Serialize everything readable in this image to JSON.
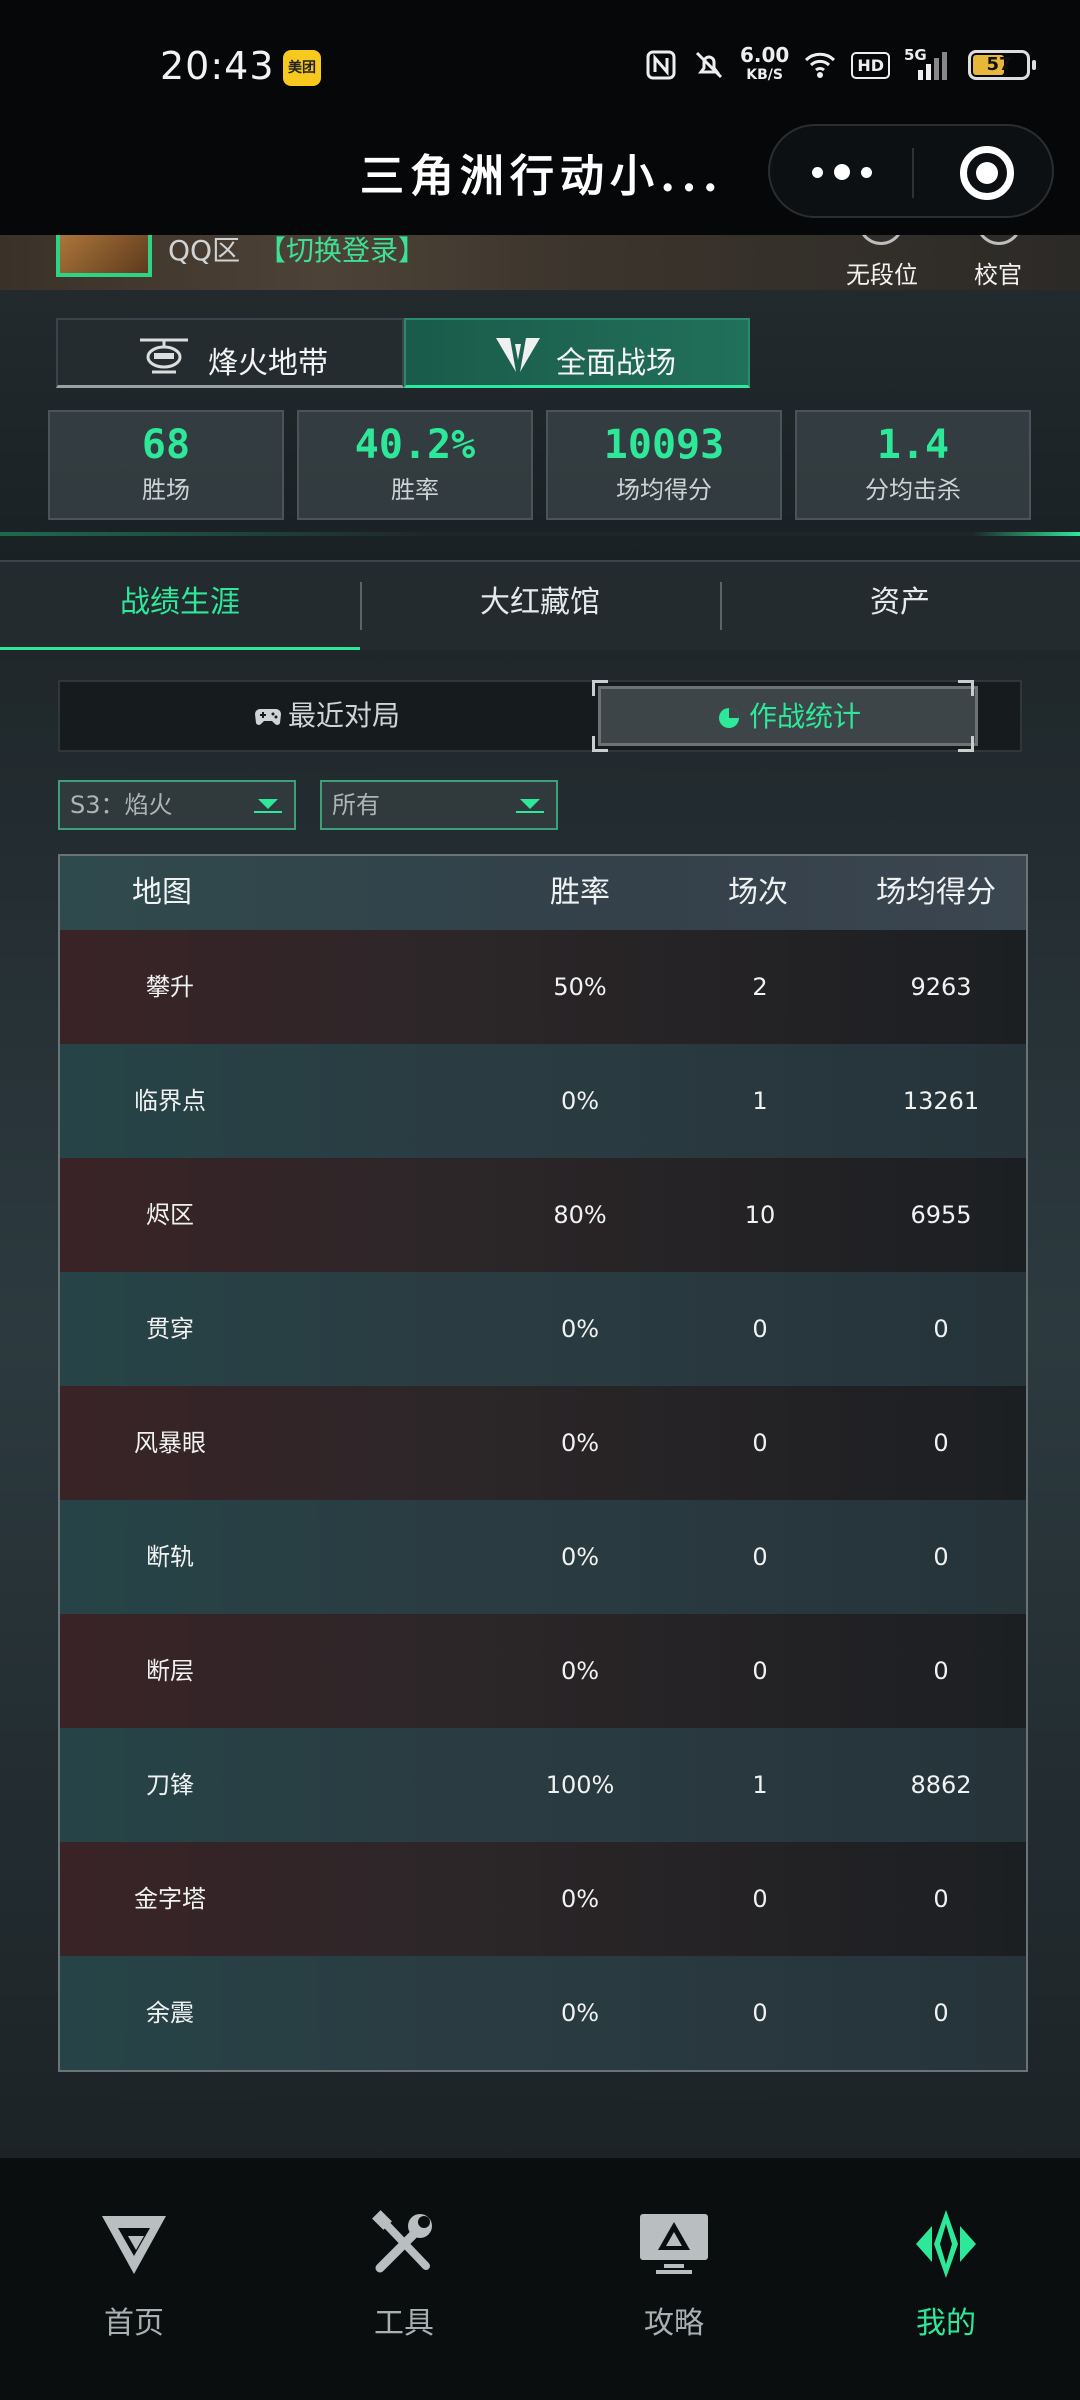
{
  "status_bar": {
    "time": "20:43",
    "meituan_badge": "美团",
    "net_speed": "6.00",
    "net_unit": "KB/S",
    "hd": "HD",
    "signal_type": "5G",
    "battery": "57",
    "icons": [
      "nfc-icon",
      "mute-icon",
      "wifi-icon",
      "signal-icon",
      "battery-icon"
    ]
  },
  "title_bar": {
    "title": "三角洲行动小...",
    "more_icon": "more-dots-icon",
    "close_icon": "target-close-icon"
  },
  "profile": {
    "region": "QQ区",
    "switch_login": "【切换登录】",
    "rank_label": "无段位",
    "title_label": "校官"
  },
  "mode_tabs": [
    {
      "label": "烽火地带",
      "icon": "helicopter-icon",
      "active": false
    },
    {
      "label": "全面战场",
      "icon": "battlefield-emblem-icon",
      "active": true
    }
  ],
  "stats": [
    {
      "value": "68",
      "label": "胜场"
    },
    {
      "value": "40.2%",
      "label": "胜率"
    },
    {
      "value": "10093",
      "label": "场均得分"
    },
    {
      "value": "1.4",
      "label": "分均击杀"
    }
  ],
  "main_tabs": [
    {
      "label": "战绩生涯",
      "active": true
    },
    {
      "label": "大红藏馆",
      "active": false
    },
    {
      "label": "资产",
      "active": false
    }
  ],
  "sub_tabs": [
    {
      "label": "最近对局",
      "icon": "gamepad-icon",
      "active": false
    },
    {
      "label": "作战统计",
      "icon": "pie-chart-icon",
      "active": true
    }
  ],
  "filters": {
    "season": "S3：焰火",
    "mode": "所有"
  },
  "table": {
    "headers": {
      "map": "地图",
      "win_rate": "胜率",
      "count": "场次",
      "avg_score": "场均得分"
    },
    "rows": [
      {
        "map": "攀升",
        "win_rate": "50%",
        "count": "2",
        "avg_score": "9263"
      },
      {
        "map": "临界点",
        "win_rate": "0%",
        "count": "1",
        "avg_score": "13261"
      },
      {
        "map": "烬区",
        "win_rate": "80%",
        "count": "10",
        "avg_score": "6955"
      },
      {
        "map": "贯穿",
        "win_rate": "0%",
        "count": "0",
        "avg_score": "0"
      },
      {
        "map": "风暴眼",
        "win_rate": "0%",
        "count": "0",
        "avg_score": "0"
      },
      {
        "map": "断轨",
        "win_rate": "0%",
        "count": "0",
        "avg_score": "0"
      },
      {
        "map": "断层",
        "win_rate": "0%",
        "count": "0",
        "avg_score": "0"
      },
      {
        "map": "刀锋",
        "win_rate": "100%",
        "count": "1",
        "avg_score": "8862"
      },
      {
        "map": "金字塔",
        "win_rate": "0%",
        "count": "0",
        "avg_score": "0"
      },
      {
        "map": "余震",
        "win_rate": "0%",
        "count": "0",
        "avg_score": "0"
      }
    ]
  },
  "bottom_nav": [
    {
      "label": "首页",
      "icon": "home-logo-icon",
      "active": false
    },
    {
      "label": "工具",
      "icon": "tools-icon",
      "active": false
    },
    {
      "label": "攻略",
      "icon": "guide-monitor-icon",
      "active": false
    },
    {
      "label": "我的",
      "icon": "profile-emblem-icon",
      "active": true
    }
  ],
  "colors": {
    "accent": "#2ee89a",
    "background": "#0d1012"
  }
}
